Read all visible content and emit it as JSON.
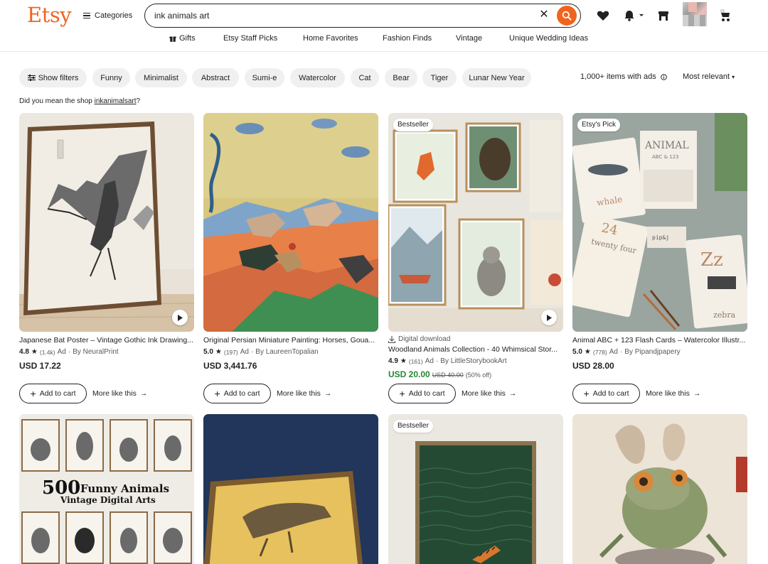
{
  "header": {
    "logo": "Etsy",
    "categories_label": "Categories",
    "search_value": "ink animals art",
    "subnav": [
      "Gifts",
      "Etsy Staff Picks",
      "Home Favorites",
      "Fashion Finds",
      "Vintage",
      "Unique Wedding Ideas"
    ]
  },
  "filters": {
    "show_filters": "Show filters",
    "chips": [
      "Funny",
      "Minimalist",
      "Abstract",
      "Sumi-e",
      "Watercolor",
      "Cat",
      "Bear",
      "Tiger",
      "Lunar New Year"
    ],
    "items_count": "1,000+ items with ads",
    "sort": "Most relevant"
  },
  "suggestion": {
    "prefix": "Did you mean the shop ",
    "shop": "inkanimalsart",
    "suffix": "?"
  },
  "listings": [
    {
      "title": "Japanese Bat Poster – Vintage Gothic Ink Drawing...",
      "rating": "4.8",
      "reviews": "(1.4k)",
      "ad": "Ad",
      "shop": "By NeuralPrint",
      "price": "USD 17.22",
      "cart": "Add to cart",
      "more": "More like this"
    },
    {
      "title": "Original Persian Miniature Painting: Horses, Goua...",
      "rating": "5.0",
      "reviews": "(197)",
      "ad": "Ad",
      "shop": "By LaureenTopalian",
      "price": "USD 3,441.76",
      "cart": "Add to cart",
      "more": "More like this"
    },
    {
      "badge": "Bestseller",
      "download": "Digital download",
      "title": "Woodland Animals Collection - 40 Whimsical Stor...",
      "rating": "4.9",
      "reviews": "(161)",
      "ad": "Ad",
      "shop": "By LittleStorybookArt",
      "price": "USD 20.00",
      "orig_price": "USD 40.00",
      "discount": "(50% off)",
      "cart": "Add to cart",
      "more": "More like this"
    },
    {
      "badge": "Etsy's Pick",
      "title": "Animal ABC + 123 Flash Cards – Watercolor Illustr...",
      "rating": "5.0",
      "reviews": "(778)",
      "ad": "Ad",
      "shop": "By Pipandjpapery",
      "price": "USD 28.00",
      "cart": "Add to cart",
      "more": "More like this"
    }
  ],
  "row2": [
    {
      "image_text_1": "500",
      "image_text_2": "Funny Animals",
      "image_text_3": "Vintage Digital Arts"
    },
    {},
    {
      "badge": "Bestseller"
    },
    {}
  ],
  "images_text": {
    "card4_big": "ANIMAL",
    "card4_sub": "ABC & 123",
    "card4_whale": "whale",
    "card4_24": "24",
    "card4_twenty": "twenty four",
    "card4_z": "Zz",
    "card4_zebra": "zebra",
    "card4_brand": "pip&j"
  },
  "colors": {
    "brand": "#f1641e",
    "chip_bg": "#f0f0f0",
    "sale": "#258635"
  }
}
